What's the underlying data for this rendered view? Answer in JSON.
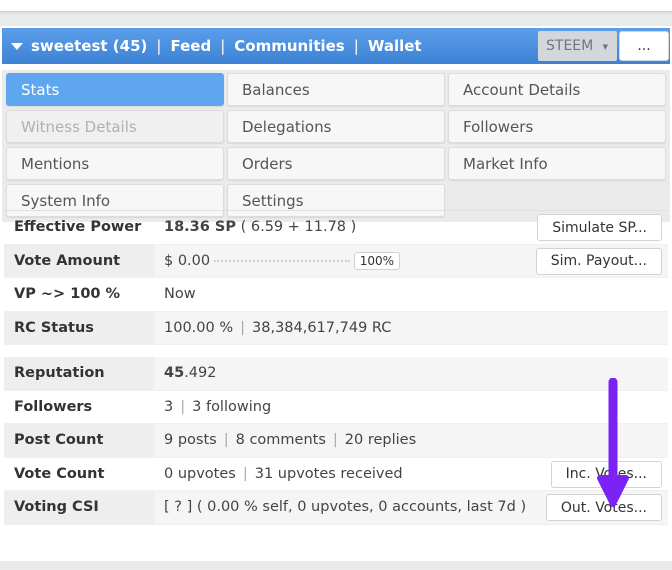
{
  "userbar": {
    "user": "sweetest (45)",
    "links": [
      "Feed",
      "Communities",
      "Wallet"
    ],
    "separator": "|",
    "currency": "STEEM",
    "more": "..."
  },
  "tabs": [
    {
      "label": "Stats",
      "state": "active"
    },
    {
      "label": "Balances",
      "state": "normal"
    },
    {
      "label": "Account Details",
      "state": "normal"
    },
    {
      "label": "Witness Details",
      "state": "disabled"
    },
    {
      "label": "Delegations",
      "state": "normal"
    },
    {
      "label": "Followers",
      "state": "normal"
    },
    {
      "label": "Mentions",
      "state": "normal"
    },
    {
      "label": "Orders",
      "state": "normal"
    },
    {
      "label": "Market Info",
      "state": "normal"
    },
    {
      "label": "System Info",
      "state": "normal"
    },
    {
      "label": "Settings",
      "state": "normal"
    }
  ],
  "stats": {
    "effective_power": {
      "label": "Effective Power",
      "value": "18.36 SP",
      "detail": "( 6.59 + 11.78 )",
      "button": "Simulate SP..."
    },
    "vote_amount": {
      "label": "Vote Amount",
      "value": "$ 0.00",
      "slider_pct": "100%",
      "button": "Sim. Payout..."
    },
    "vp": {
      "label": "VP ~> 100 %",
      "value": "Now"
    },
    "rc_status": {
      "label": "RC Status",
      "pct": "100.00 %",
      "rc": "38,384,617,749 RC"
    },
    "reputation": {
      "label": "Reputation",
      "int": "45",
      "dec": ".492"
    },
    "followers": {
      "label": "Followers",
      "count": "3",
      "following": "3 following"
    },
    "post_count": {
      "label": "Post Count",
      "posts": "9 posts",
      "comments": "8 comments",
      "replies": "20 replies"
    },
    "vote_count": {
      "label": "Vote Count",
      "upvotes": "0 upvotes",
      "received": "31 upvotes received",
      "button": "Inc. Votes..."
    },
    "voting_csi": {
      "label": "Voting CSI",
      "value": "[ ? ] ( 0.00 % self, 0 upvotes, 0 accounts, last 7d )",
      "button": "Out. Votes..."
    }
  },
  "colors": {
    "accent": "#4a90e2",
    "active_tab": "#5ea6f0",
    "annotation_arrow": "#7b22f5"
  }
}
